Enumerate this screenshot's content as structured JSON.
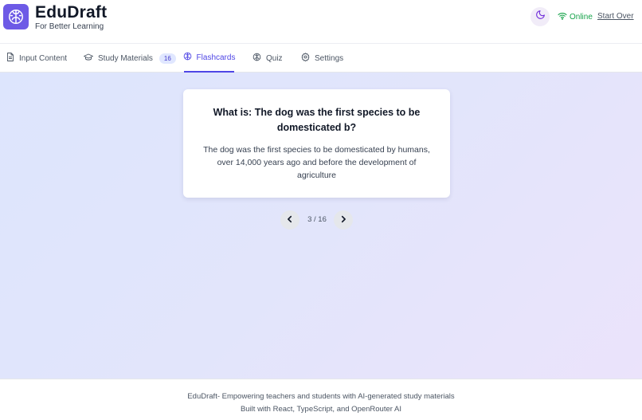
{
  "app": {
    "title": "EduDraft",
    "subtitle": "For Better Learning",
    "logo_icon": "brain-icon",
    "accent_color": "#6d5ae6"
  },
  "header": {
    "theme_toggle_icon": "moon-icon",
    "status_label": "Online",
    "status_color": "#16a34a",
    "start_over_label": "Start Over"
  },
  "tabs": [
    {
      "label": "Input Content",
      "icon": "document-icon",
      "active": false
    },
    {
      "label": "Study Materials",
      "icon": "graduation-cap-icon",
      "badge": "16",
      "active": false
    },
    {
      "label": "Flashcards",
      "icon": "brain-icon",
      "active": true
    },
    {
      "label": "Quiz",
      "icon": "brain-icon",
      "active": false
    },
    {
      "label": "Settings",
      "icon": "gear-icon",
      "active": false
    }
  ],
  "flashcard": {
    "question": "What is: The dog was the first species to be domesticated b?",
    "answer": "The dog was the first species to be domesticated by humans, over 14,000 years ago and before the development of agriculture"
  },
  "pagination": {
    "counter": "3 / 16",
    "prev_icon": "chevron-left-icon",
    "next_icon": "chevron-right-icon"
  },
  "footer": {
    "line1": "EduDraft- Empowering teachers and students with AI-generated study materials",
    "line2": "Built with React, TypeScript, and OpenRouter AI"
  }
}
